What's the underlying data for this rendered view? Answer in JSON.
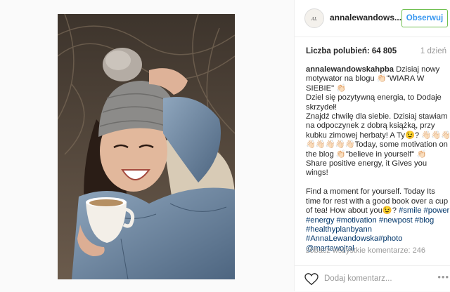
{
  "header": {
    "username": "annalewandows...",
    "follow_label": "Obserwuj"
  },
  "post": {
    "likes_text": "Liczba polubień: 64 805",
    "time_text": "1 dzień",
    "caption_user": "annalewandowskahpba",
    "caption_text_1": " Dzisiaj nowy motywator na blogu 👏🏻\"WIARA W SIEBIE\" 👏🏻\nDziel się pozytywną energia, to Dodaje skrzydeł!\nZnajdź chwilę dla siebie. Dzisiaj stawiam na odpoczynek z dobrą książką, przy kubku zimowej herbaty! A Ty😉? 👋🏻👋🏻👋🏻👋🏻👋🏻👋🏻👋🏻👋🏻Today, some motivation on the blog 👏🏻\"believe in yourself\" 👏🏻\nShare positive energy, it Gives you wings!\n\nFind a moment for yourself. Today Its time for rest with a good book over a cup of tea! How about you😉? ",
    "hashtags_1": "#smile #power #energy #motivation #newpost #blog #healthyplanbyann #AnnaLewandowska#photo",
    "mention": "@martawojtal",
    "view_all_comments": "zobacz wszystkie komentarze: 246"
  },
  "comment_bar": {
    "placeholder": "Dodaj komentarz...",
    "more_label": "•••"
  },
  "icons": {
    "heart": "heart-icon",
    "avatar": "avatar-icon"
  },
  "colors": {
    "follow_text": "#3897f0",
    "follow_border": "#70c050",
    "hashtag": "#003569",
    "muted": "#999999"
  }
}
